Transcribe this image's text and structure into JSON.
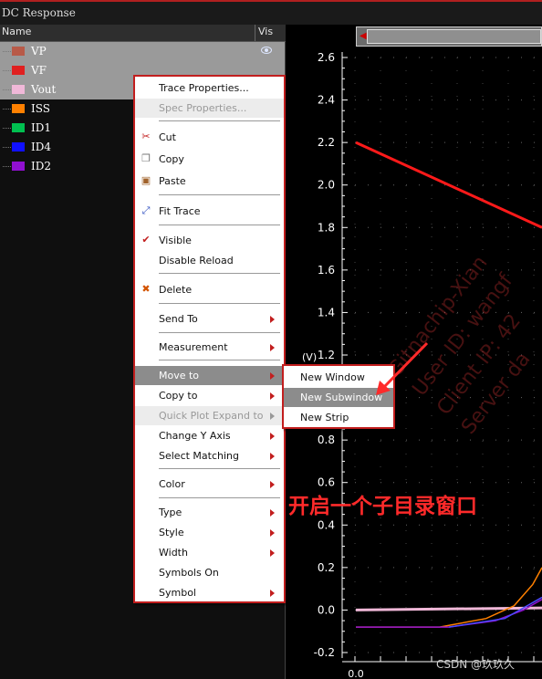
{
  "window": {
    "title": "DC Response"
  },
  "legend": {
    "col_name": "Name",
    "col_vis": "Vis",
    "traces": [
      {
        "label": "VP",
        "color": "#b85a48",
        "selected": true,
        "visible_icon": true
      },
      {
        "label": "VF",
        "color": "#e02020",
        "selected": true,
        "visible_icon": false
      },
      {
        "label": "Vout",
        "color": "#f0b8d8",
        "selected": true,
        "visible_icon": false
      },
      {
        "label": "ISS",
        "color": "#ff8000",
        "selected": false,
        "visible_icon": false
      },
      {
        "label": "ID1",
        "color": "#00c050",
        "selected": false,
        "visible_icon": false
      },
      {
        "label": "ID4",
        "color": "#1010ff",
        "selected": false,
        "visible_icon": false
      },
      {
        "label": "ID2",
        "color": "#9010d0",
        "selected": false,
        "visible_icon": false
      }
    ]
  },
  "context_menu": {
    "trace_properties": "Trace Properties...",
    "spec_properties": "Spec Properties...",
    "cut": "Cut",
    "copy": "Copy",
    "paste": "Paste",
    "fit_trace": "Fit Trace",
    "visible": "Visible",
    "disable_reload": "Disable Reload",
    "delete": "Delete",
    "send_to": "Send To",
    "measurement": "Measurement",
    "move_to": "Move to",
    "copy_to": "Copy to",
    "quick_plot_expand_to": "Quick Plot Expand to",
    "change_y_axis": "Change Y Axis",
    "select_matching": "Select Matching",
    "color": "Color",
    "type": "Type",
    "style": "Style",
    "width": "Width",
    "symbols_on": "Symbols On",
    "symbol": "Symbol"
  },
  "submenu": {
    "new_window": "New Window",
    "new_subwindow": "New Subwindow",
    "new_strip": "New Strip"
  },
  "plot": {
    "y_axis_label": "(V)",
    "y_ticks": [
      "2.6",
      "2.4",
      "2.2",
      "2.0",
      "1.8",
      "1.6",
      "1.4",
      "1.2",
      "1.0",
      "0.8",
      "0.6",
      "0.4",
      "0.2",
      "0.0",
      "-0.2"
    ],
    "x_tick_partial": "0.0"
  },
  "chart_data": {
    "type": "line",
    "ylabel": "(V)",
    "ylim": [
      -0.2,
      2.6
    ],
    "series": [
      {
        "name": "VF",
        "color": "#ff1a1a",
        "points": [
          [
            0,
            2.2
          ],
          [
            1,
            1.8
          ]
        ]
      },
      {
        "name": "Vout",
        "color": "#f0b8d8",
        "points": [
          [
            0,
            0.0
          ],
          [
            1,
            0.01
          ]
        ]
      },
      {
        "name": "ISS",
        "color": "#ff8000",
        "points": [
          [
            0,
            -0.08
          ],
          [
            0.45,
            -0.08
          ],
          [
            0.7,
            -0.04
          ],
          [
            0.85,
            0.02
          ],
          [
            0.95,
            0.12
          ],
          [
            1,
            0.2
          ]
        ]
      },
      {
        "name": "ID2",
        "color": "#9010d0",
        "points": [
          [
            0,
            -0.08
          ],
          [
            0.5,
            -0.08
          ],
          [
            0.75,
            -0.05
          ],
          [
            0.9,
            -0.0
          ],
          [
            1,
            0.05
          ]
        ]
      },
      {
        "name": "ID4",
        "color": "#4a4aff",
        "points": [
          [
            0.5,
            -0.08
          ],
          [
            0.8,
            -0.04
          ],
          [
            1,
            0.06
          ]
        ]
      }
    ]
  },
  "overlays": {
    "annotation": "开启一个子目录窗口",
    "watermark_lines": [
      "Gitnachip-Xian",
      "User ID: wangf",
      "Client IP: 42",
      "Server da"
    ],
    "footer": "CSDN @玖玖久"
  },
  "colors": {
    "menu_border": "#c21e1e",
    "highlight": "#8c8c8c",
    "annotation": "#ff2a2a"
  }
}
